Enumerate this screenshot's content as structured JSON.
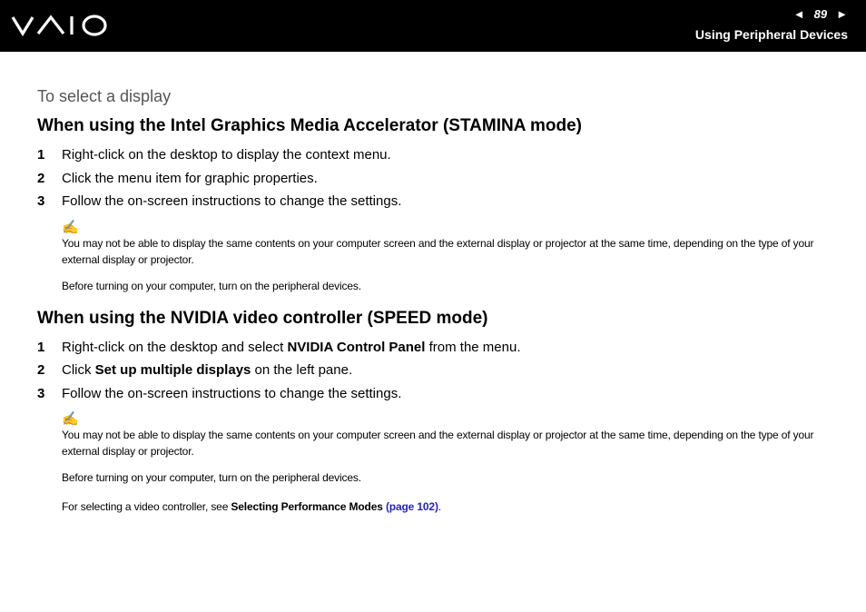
{
  "header": {
    "page_number": "89",
    "section_title": "Using Peripheral Devices",
    "prev_arrow": "◄",
    "next_arrow": "►"
  },
  "procedure_title": "To select a display",
  "section1": {
    "heading": "When using the Intel Graphics Media Accelerator (STAMINA mode)",
    "steps": [
      {
        "num": "1",
        "text": "Right-click on the desktop to display the context menu."
      },
      {
        "num": "2",
        "text": "Click the menu item for graphic properties."
      },
      {
        "num": "3",
        "text": "Follow the on-screen instructions to change the settings."
      }
    ],
    "note_icon": "✍",
    "notes": [
      "You may not be able to display the same contents on your computer screen and the external display or projector at the same time, depending on the type of your external display or projector.",
      "Before turning on your computer, turn on the peripheral devices."
    ]
  },
  "section2": {
    "heading": "When using the NVIDIA video controller (SPEED mode)",
    "step1": {
      "num": "1",
      "pre": "Right-click on the desktop and select ",
      "bold": "NVIDIA Control Panel",
      "post": " from the menu."
    },
    "step2": {
      "num": "2",
      "pre": "Click ",
      "bold": "Set up multiple displays",
      "post": " on the left pane."
    },
    "step3": {
      "num": "3",
      "text": "Follow the on-screen instructions to change the settings."
    },
    "note_icon": "✍",
    "notes": [
      "You may not be able to display the same contents on your computer screen and the external display or projector at the same time, depending on the type of your external display or projector.",
      "Before turning on your computer, turn on the peripheral devices."
    ],
    "ref": {
      "pre": "For selecting a video controller, see ",
      "bold": "Selecting Performance Modes",
      "link": "(page 102)",
      "post": "."
    }
  }
}
